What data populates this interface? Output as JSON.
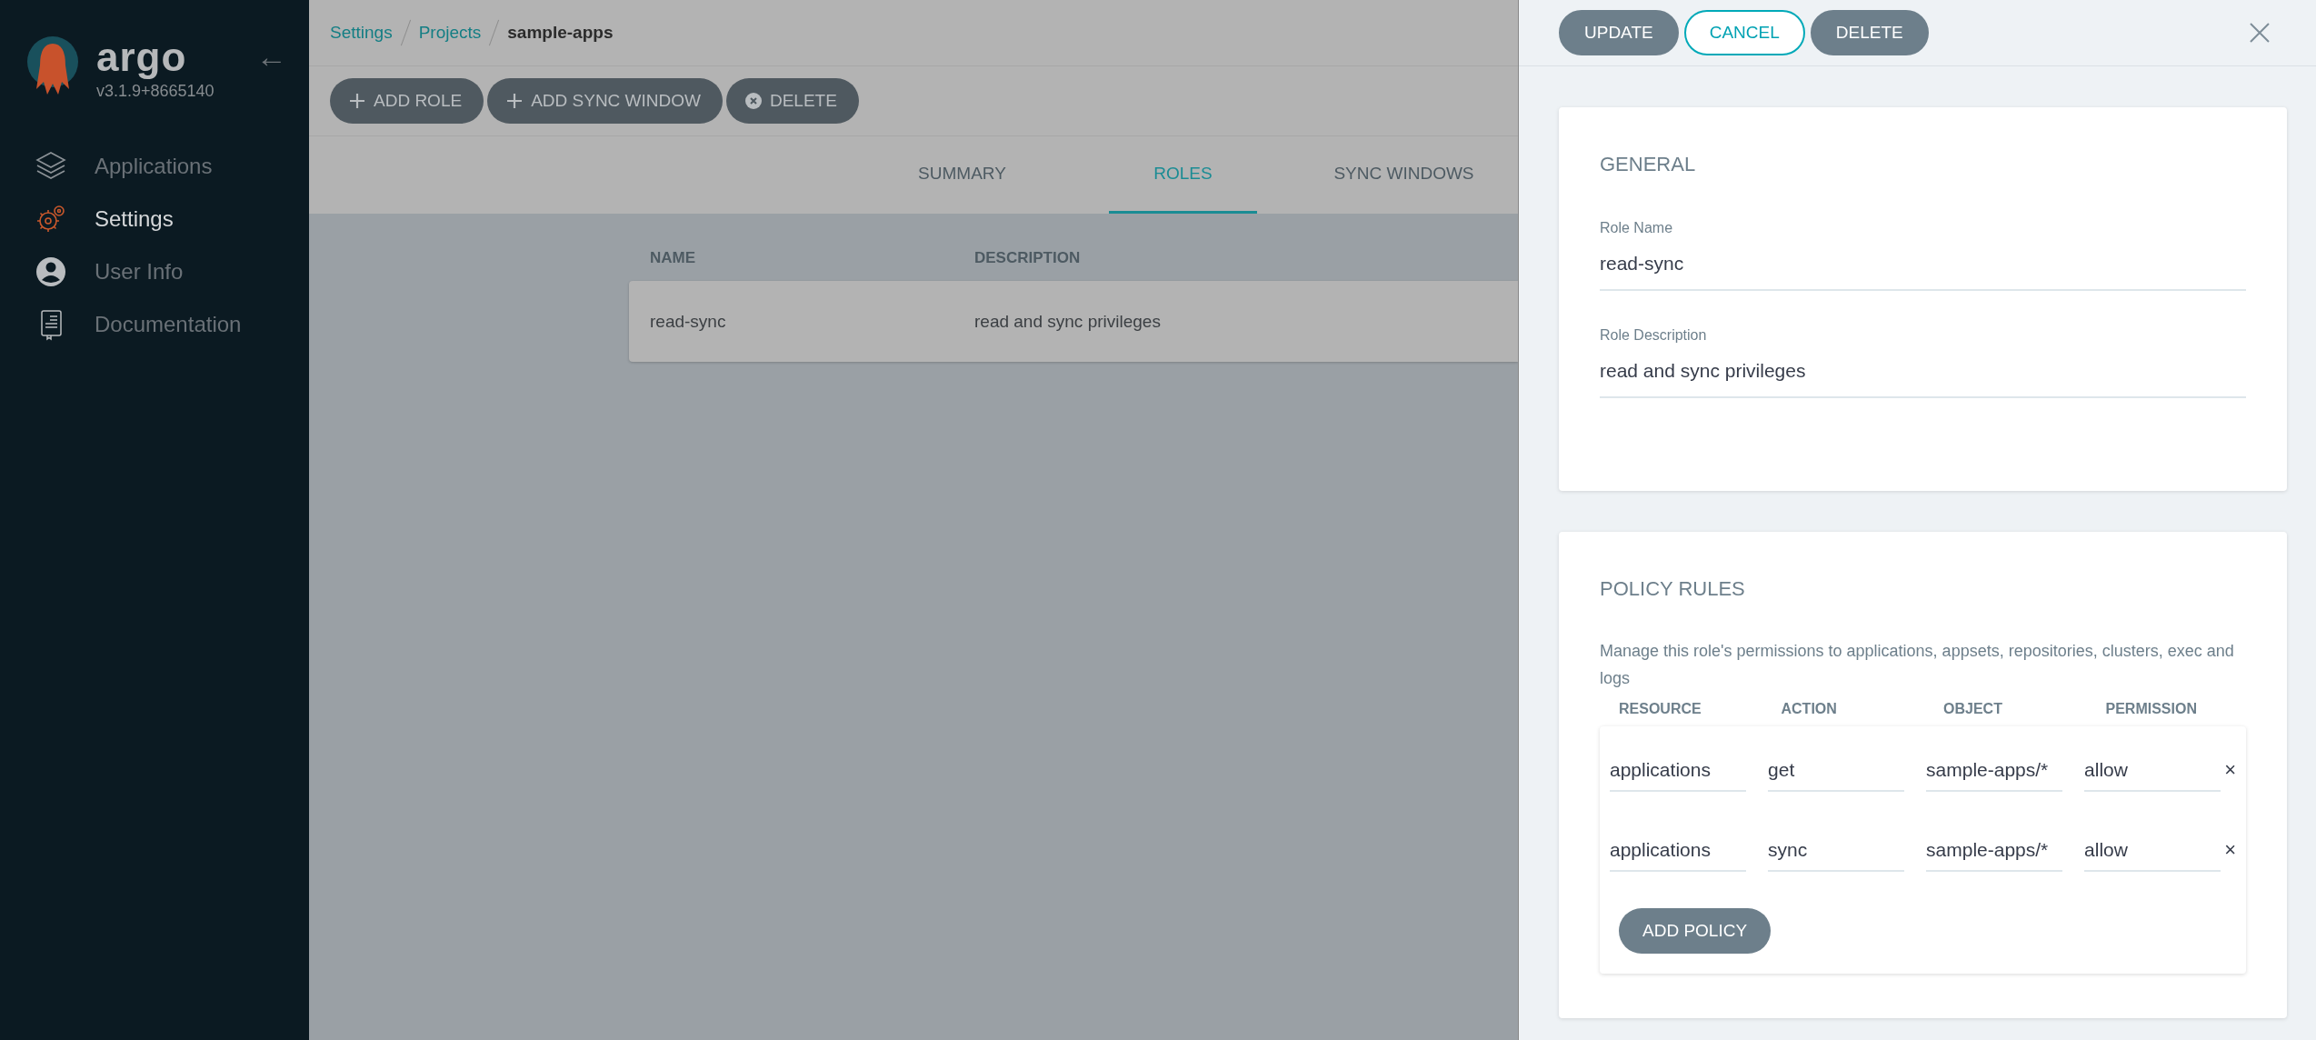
{
  "sidebar": {
    "logo_text": "argo",
    "version": "v3.1.9+8665140",
    "collapse_icon": "←",
    "items": [
      {
        "kind": "layers",
        "label": "Applications",
        "selected": false
      },
      {
        "kind": "gear",
        "label": "Settings",
        "selected": true
      },
      {
        "kind": "user",
        "label": "User Info",
        "selected": false
      },
      {
        "kind": "book",
        "label": "Documentation",
        "selected": false
      }
    ]
  },
  "breadcrumbs": [
    {
      "label": "Settings",
      "link": true
    },
    {
      "label": "Projects",
      "link": true
    },
    {
      "label": "sample-apps",
      "link": false
    }
  ],
  "toolbar": [
    {
      "kind": "plus",
      "label": "ADD ROLE"
    },
    {
      "kind": "plus",
      "label": "ADD SYNC WINDOW"
    },
    {
      "kind": "remove",
      "label": "DELETE"
    }
  ],
  "tabs": [
    {
      "label": "SUMMARY",
      "selected": false
    },
    {
      "label": "ROLES",
      "selected": true
    },
    {
      "label": "SYNC WINDOWS",
      "selected": false
    }
  ],
  "table": {
    "columns": [
      "NAME",
      "DESCRIPTION"
    ],
    "rows": [
      [
        "read-sync",
        "read and sync privileges"
      ]
    ]
  },
  "panel": {
    "buttons": [
      {
        "kind": "filled",
        "label": "UPDATE"
      },
      {
        "kind": "outline",
        "label": "CANCEL"
      },
      {
        "kind": "filled",
        "label": "DELETE"
      }
    ],
    "general": {
      "title": "GENERAL",
      "fields": [
        {
          "label": "Role Name",
          "value": "read-sync"
        },
        {
          "label": "Role Description",
          "value": "read and sync privileges"
        }
      ]
    },
    "policy": {
      "title": "POLICY RULES",
      "description": "Manage this role's permissions to applications, appsets, repositories, clusters, exec and logs",
      "columns": [
        "RESOURCE",
        "ACTION",
        "OBJECT",
        "PERMISSION"
      ],
      "rows": [
        [
          "applications",
          "get",
          "sample-apps/*",
          "allow"
        ],
        [
          "applications",
          "sync",
          "sample-apps/*",
          "allow"
        ]
      ],
      "remove_label": "×",
      "add_button": "ADD POLICY"
    }
  }
}
